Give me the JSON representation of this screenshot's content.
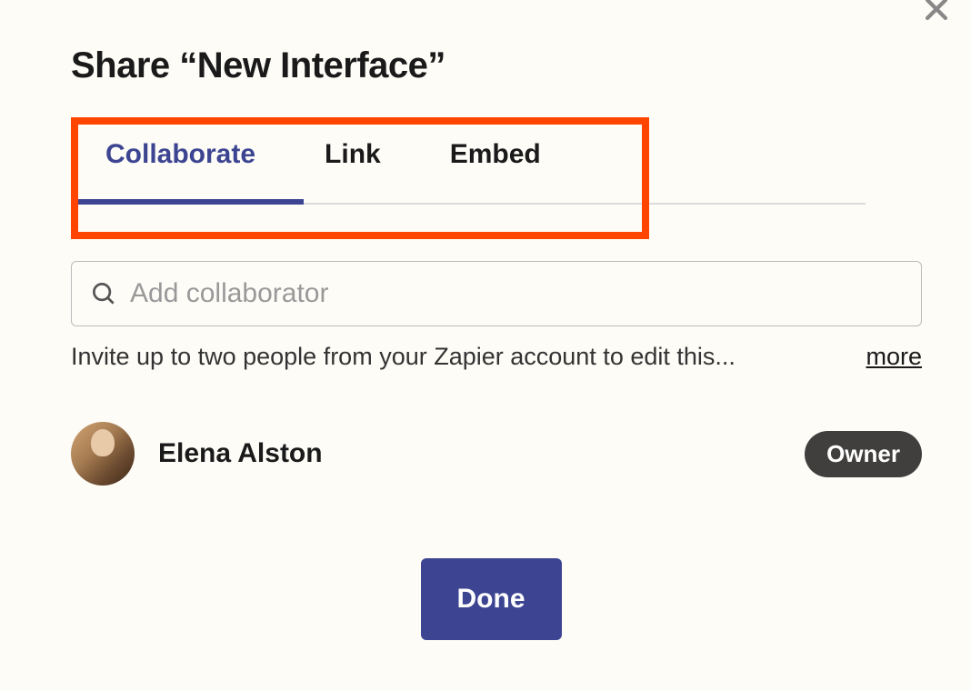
{
  "header": {
    "title": "Share “New Interface”"
  },
  "tabs": {
    "items": [
      {
        "label": "Collaborate",
        "active": true
      },
      {
        "label": "Link",
        "active": false
      },
      {
        "label": "Embed",
        "active": false
      }
    ]
  },
  "collaboratorInput": {
    "placeholder": "Add collaborator",
    "value": ""
  },
  "helper": {
    "text": "Invite up to two people from your Zapier account to edit this...",
    "moreLabel": "more"
  },
  "collaborators": [
    {
      "name": "Elena Alston",
      "role": "Owner"
    }
  ],
  "actions": {
    "doneLabel": "Done"
  },
  "icons": {
    "close": "close-icon",
    "search": "search-icon"
  },
  "colors": {
    "accent": "#3d4592",
    "highlight": "#ff4500",
    "badgeBg": "#403f3e"
  }
}
